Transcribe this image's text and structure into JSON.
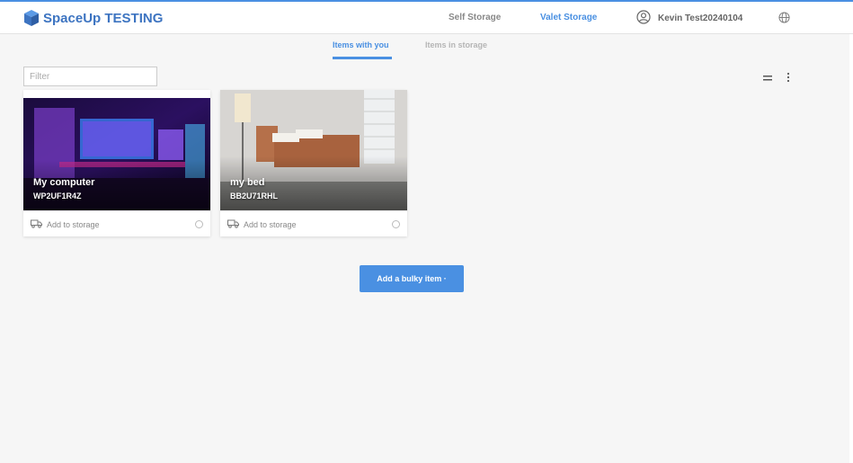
{
  "header": {
    "title": "SpaceUp TESTING",
    "logo_icon": "cube-icon",
    "brand_color": "#3d74c1",
    "accent_color": "#4a90e2",
    "nav": {
      "self_storage": "Self Storage",
      "valet_storage": "Valet Storage"
    },
    "user_name": "Kevin Test20240104",
    "user_icon": "user-circle-icon",
    "language_icon": "globe-icon"
  },
  "tabs": {
    "items_with_you": "Items with you",
    "items_in_storage": "Items in storage"
  },
  "filter": {
    "placeholder": "Filter",
    "value": ""
  },
  "toolbar": {
    "view_icon": "list-view-icon",
    "more_icon": "more-vertical-icon"
  },
  "items": [
    {
      "name": "My computer",
      "code": "WP2UF1R4Z",
      "action": "Add to storage",
      "action_icon": "truck-icon"
    },
    {
      "name": "my bed",
      "code": "BB2U71RHL",
      "action": "Add to storage",
      "action_icon": "truck-icon"
    }
  ],
  "bulky_button": {
    "label": "Add a bulky item ·"
  }
}
